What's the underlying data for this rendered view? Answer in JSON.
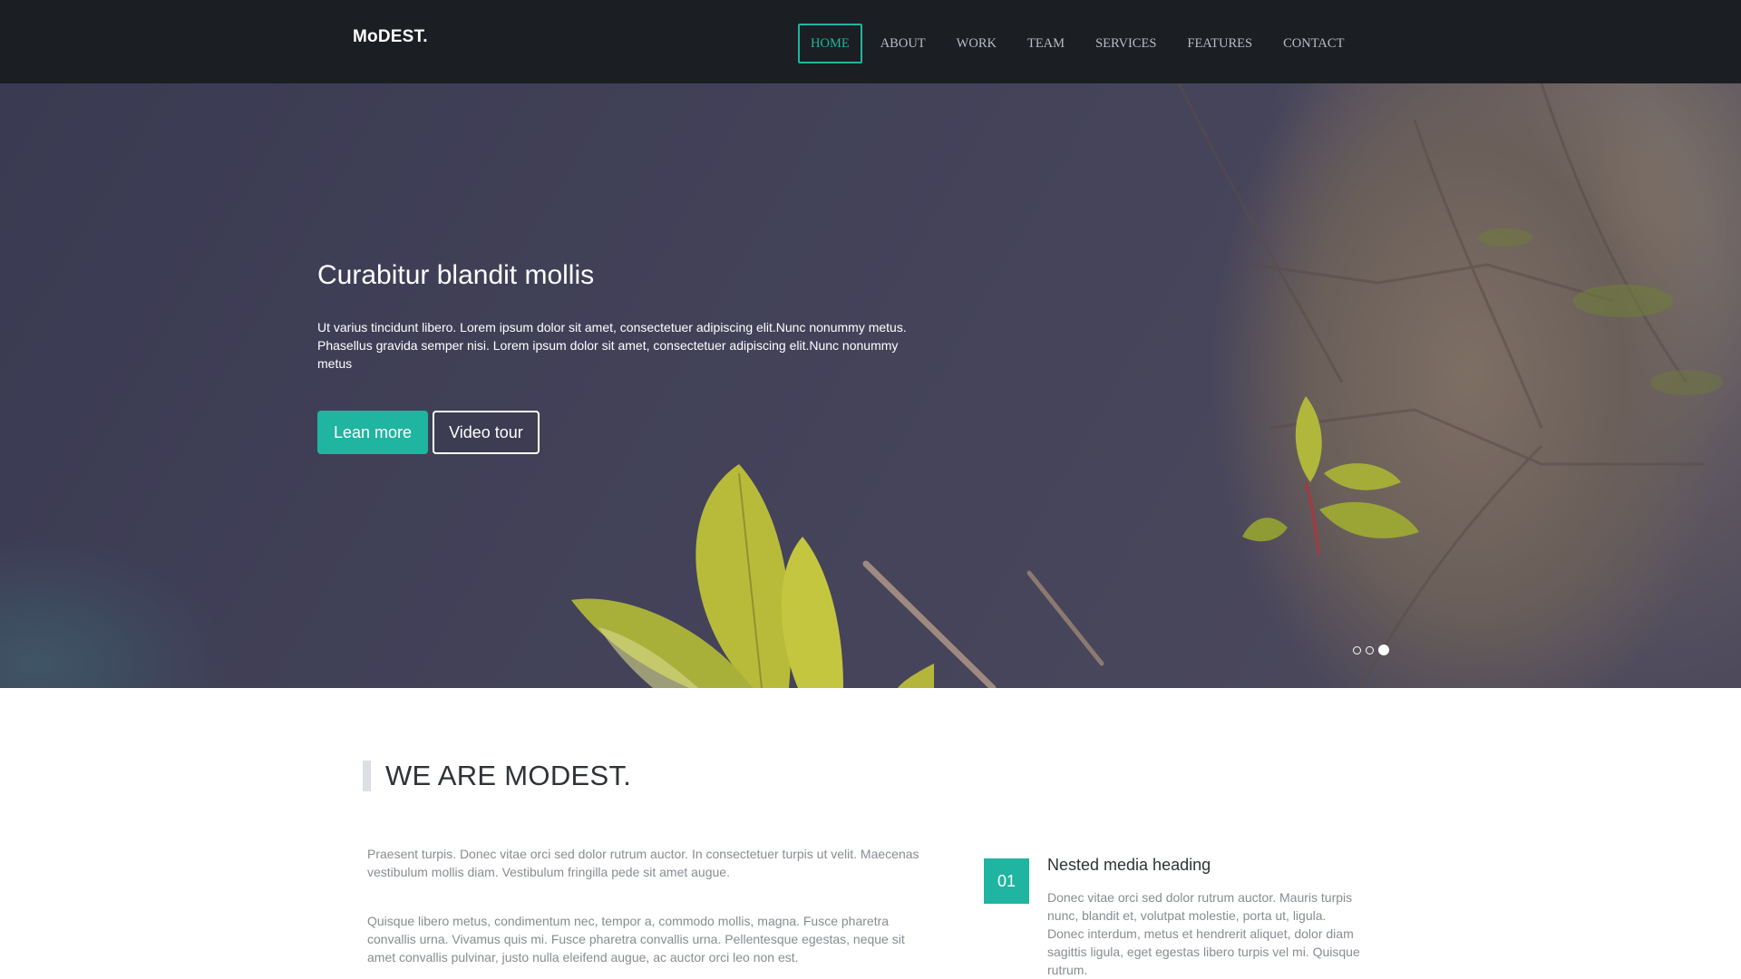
{
  "navbar": {
    "brand": "MoDEST.",
    "items": [
      {
        "label": "HOME",
        "active": true
      },
      {
        "label": "ABOUT",
        "active": false
      },
      {
        "label": "WORK",
        "active": false
      },
      {
        "label": "TEAM",
        "active": false
      },
      {
        "label": "SERVICES",
        "active": false
      },
      {
        "label": "FEATURES",
        "active": false
      },
      {
        "label": "CONTACT",
        "active": false
      }
    ]
  },
  "hero": {
    "title": "Curabitur blandit mollis",
    "text": "Ut varius tincidunt libero. Lorem ipsum dolor sit amet, consectetuer adipiscing elit.Nunc nonummy metus. Phasellus gravida semper nisi. Lorem ipsum dolor sit amet, consectetuer adipiscing elit.Nunc nonummy metus",
    "primary_button": "Lean more",
    "secondary_button": "Video tour",
    "slides_total": 3,
    "active_slide": 3
  },
  "about": {
    "title": "WE ARE MODEST.",
    "paragraphs": [
      "Praesent turpis. Donec vitae orci sed dolor rutrum auctor. In consectetuer turpis ut velit. Maecenas vestibulum mollis diam. Vestibulum fringilla pede sit amet augue.",
      "Quisque libero metus, condimentum nec, tempor a, commodo mollis, magna. Fusce pharetra convallis urna. Vivamus quis mi. Fusce pharetra convallis urna. Pellentesque egestas, neque sit amet convallis pulvinar, justo nulla eleifend augue, ac auctor orci leo non est."
    ],
    "media": {
      "number": "01",
      "heading": "Nested media heading",
      "body": "Donec vitae orci sed dolor rutrum auctor. Mauris turpis nunc, blandit et, volutpat molestie, porta ut, ligula. Donec interdum, metus et hendrerit aliquet, dolor diam sagittis ligula, eget egestas libero turpis vel mi. Quisque rutrum."
    }
  },
  "colors": {
    "accent": "#1fb5a0",
    "navbar_bg": "#1b1e22",
    "nav_text": "#b9bec4",
    "heading_text": "#2f3337",
    "body_text": "#888c91"
  },
  "icons": [
    "slide-dot-icon"
  ]
}
